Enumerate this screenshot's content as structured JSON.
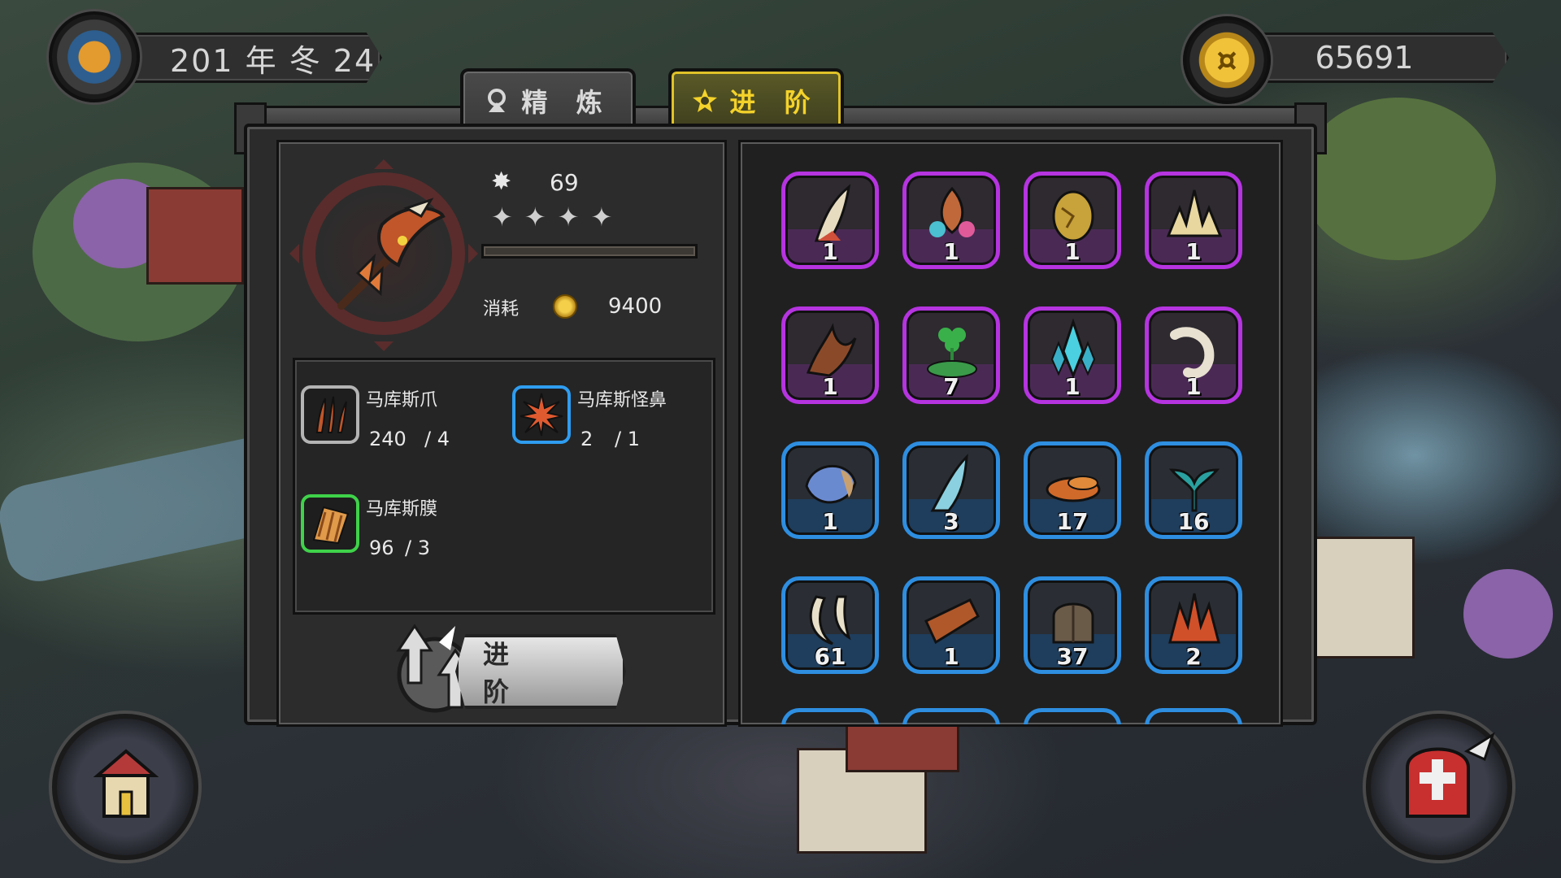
{
  "header": {
    "date_text": "201 年 冬 24",
    "gold_amount": "65691"
  },
  "tabs": {
    "refine_label": "精 炼",
    "advance_label": "进 阶",
    "active": "advance"
  },
  "equipment": {
    "level": "69",
    "stars": [
      "✦",
      "✦",
      "✦",
      "✦"
    ],
    "star_count": 4,
    "progress": 0,
    "cost_label": "消耗",
    "cost_value": "9400",
    "ring_color": "#5a2c2c"
  },
  "materials": [
    {
      "name": "马库斯爪",
      "have": "240",
      "need": "/ 4",
      "rarity": "gray",
      "icon": "claw-icon"
    },
    {
      "name": "马库斯怪鼻",
      "have": "2",
      "need": "/ 1",
      "rarity": "blue",
      "icon": "spiky-nose-icon"
    },
    {
      "name": "马库斯膜",
      "have": "96",
      "need": "/ 3",
      "rarity": "green",
      "icon": "membrane-icon"
    }
  ],
  "advance_button": {
    "label": "进 阶"
  },
  "inventory": [
    {
      "qty": "1",
      "rarity": "purple",
      "icon": "horn-icon"
    },
    {
      "qty": "1",
      "rarity": "purple",
      "icon": "flower-icon"
    },
    {
      "qty": "1",
      "rarity": "purple",
      "icon": "egg-icon"
    },
    {
      "qty": "1",
      "rarity": "purple",
      "icon": "spike-crown-icon"
    },
    {
      "qty": "1",
      "rarity": "purple",
      "icon": "root-icon"
    },
    {
      "qty": "7",
      "rarity": "purple",
      "icon": "clover-icon"
    },
    {
      "qty": "1",
      "rarity": "purple",
      "icon": "crystal-icon"
    },
    {
      "qty": "1",
      "rarity": "purple",
      "icon": "spine-icon"
    },
    {
      "qty": "1",
      "rarity": "blue",
      "icon": "shell-icon"
    },
    {
      "qty": "3",
      "rarity": "blue",
      "icon": "fin-icon"
    },
    {
      "qty": "17",
      "rarity": "blue",
      "icon": "meat-icon"
    },
    {
      "qty": "16",
      "rarity": "blue",
      "icon": "tail-icon"
    },
    {
      "qty": "61",
      "rarity": "blue",
      "icon": "fang-icon"
    },
    {
      "qty": "1",
      "rarity": "blue",
      "icon": "hide-icon"
    },
    {
      "qty": "37",
      "rarity": "blue",
      "icon": "scale-icon"
    },
    {
      "qty": "2",
      "rarity": "blue",
      "icon": "fire-leaf-icon"
    }
  ],
  "colors": {
    "accent_yellow": "#e0c228",
    "rarity_purple": "#b534e0",
    "rarity_blue": "#2e8ee0",
    "rarity_green": "#3fd24a",
    "rarity_gray": "#b4b4b4"
  }
}
